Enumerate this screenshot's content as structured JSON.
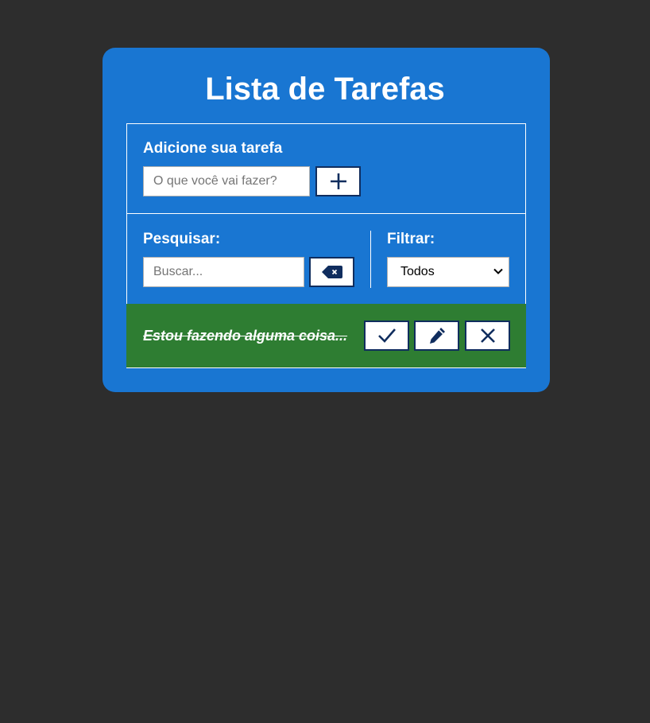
{
  "app": {
    "title": "Lista de Tarefas"
  },
  "add_section": {
    "label": "Adicione sua tarefa",
    "input_placeholder": "O que você vai fazer?",
    "input_value": "",
    "add_button_icon": "plus-icon"
  },
  "search_section": {
    "label": "Pesquisar:",
    "input_placeholder": "Buscar...",
    "input_value": "",
    "clear_button_icon": "backspace-icon"
  },
  "filter_section": {
    "label": "Filtrar:",
    "selected": "Todos"
  },
  "tasks": [
    {
      "text": "Estou fazendo alguma coisa...",
      "done": true,
      "actions": [
        "check-icon",
        "pencil-icon",
        "close-icon"
      ]
    }
  ],
  "colors": {
    "background": "#2d2d2d",
    "card": "#1976d2",
    "task_done": "#2e7d32",
    "button_border": "#102d5e",
    "text": "#ffffff"
  }
}
